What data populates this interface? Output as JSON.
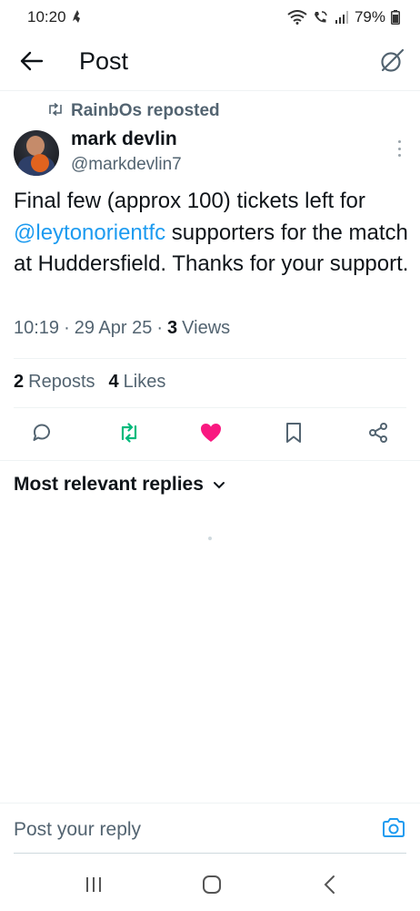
{
  "status_bar": {
    "time": "10:20",
    "battery": "79%",
    "icons": [
      "wifi-icon",
      "wifi-calling-icon",
      "signal-icon",
      "battery-icon"
    ]
  },
  "header": {
    "title": "Post",
    "back_icon": "arrow-left-icon",
    "grok_icon": "grok-icon"
  },
  "post": {
    "repost_by": "RainbOs reposted",
    "author_name": "mark devlin",
    "author_handle": "@markdevlin7",
    "text_before": "Final few (approx 100) tickets left for ",
    "mention": "@leytonorientfc",
    "text_after": " supporters for the match at Huddersfield. Thanks for your support.",
    "time": "10:19",
    "date": "29 Apr 25",
    "views_count": "3",
    "views_label": "Views",
    "reposts_count": "2",
    "reposts_label": "Reposts",
    "likes_count": "4",
    "likes_label": "Likes",
    "liked": true,
    "reposted": true
  },
  "actions": [
    "reply-icon",
    "repost-icon",
    "like-icon",
    "bookmark-icon",
    "share-icon"
  ],
  "colors": {
    "accent": "#1d9bf0",
    "like": "#f91880",
    "repost": "#00ba7c",
    "secondary_text": "#536471"
  },
  "replies": {
    "sort_label": "Most relevant replies"
  },
  "reply_bar": {
    "placeholder": "Post your reply"
  }
}
